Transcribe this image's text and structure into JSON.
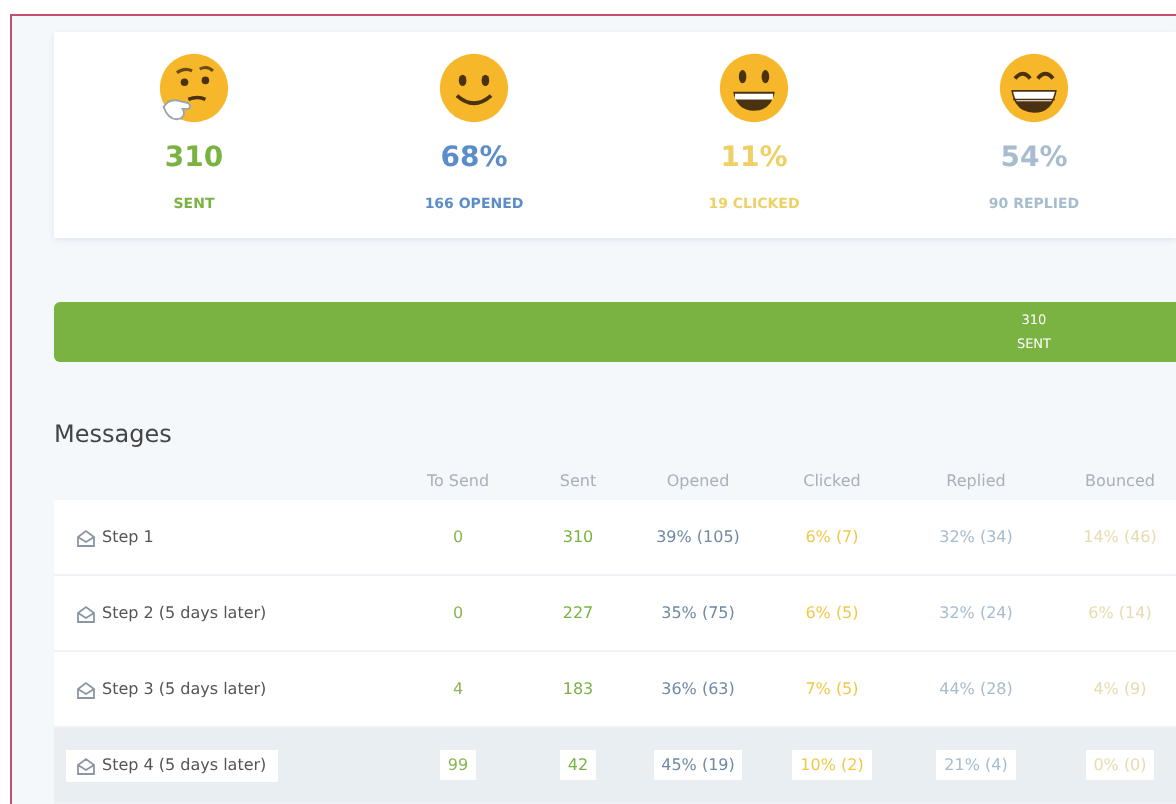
{
  "stats": [
    {
      "kind": "thinking",
      "value": "310",
      "label": "SENT",
      "color": "#7ab342"
    },
    {
      "kind": "smile",
      "value": "68%",
      "label": "166 OPENED",
      "color": "#5b8dc9"
    },
    {
      "kind": "grin",
      "value": "11%",
      "label": "19 CLICKED",
      "color": "#efd064"
    },
    {
      "kind": "beaming",
      "value": "54%",
      "label": "90 REPLIED",
      "color": "#a7bccf"
    }
  ],
  "progress": {
    "level": 1,
    "value": "310",
    "label": "SENT"
  },
  "messages": {
    "title": "Messages",
    "columns": [
      {
        "label": "To Send",
        "color": "#8bb454"
      },
      {
        "label": "Sent",
        "color": "#7ab342"
      },
      {
        "label": "Opened",
        "color": "#6f8aa5"
      },
      {
        "label": "Clicked",
        "color": "#efc94a"
      },
      {
        "label": "Replied",
        "color": "#a7bccf"
      },
      {
        "label": "Bounced",
        "color": "#e6dcae"
      }
    ],
    "rows": [
      {
        "name": "Step 1",
        "selected": false,
        "cells": [
          "0",
          "310",
          "39% (105)",
          "6% (7)",
          "32% (34)",
          "14% (46)"
        ]
      },
      {
        "name": "Step 2 (5 days later)",
        "selected": false,
        "cells": [
          "0",
          "227",
          "35% (75)",
          "6% (5)",
          "32% (24)",
          "6% (14)"
        ]
      },
      {
        "name": "Step 3 (5 days later)",
        "selected": false,
        "cells": [
          "4",
          "183",
          "36% (63)",
          "7% (5)",
          "44% (28)",
          "4% (9)"
        ]
      },
      {
        "name": "Step 4 (5 days later)",
        "selected": true,
        "cells": [
          "99",
          "42",
          "45% (19)",
          "10% (2)",
          "21% (4)",
          "0% (0)"
        ]
      }
    ]
  }
}
